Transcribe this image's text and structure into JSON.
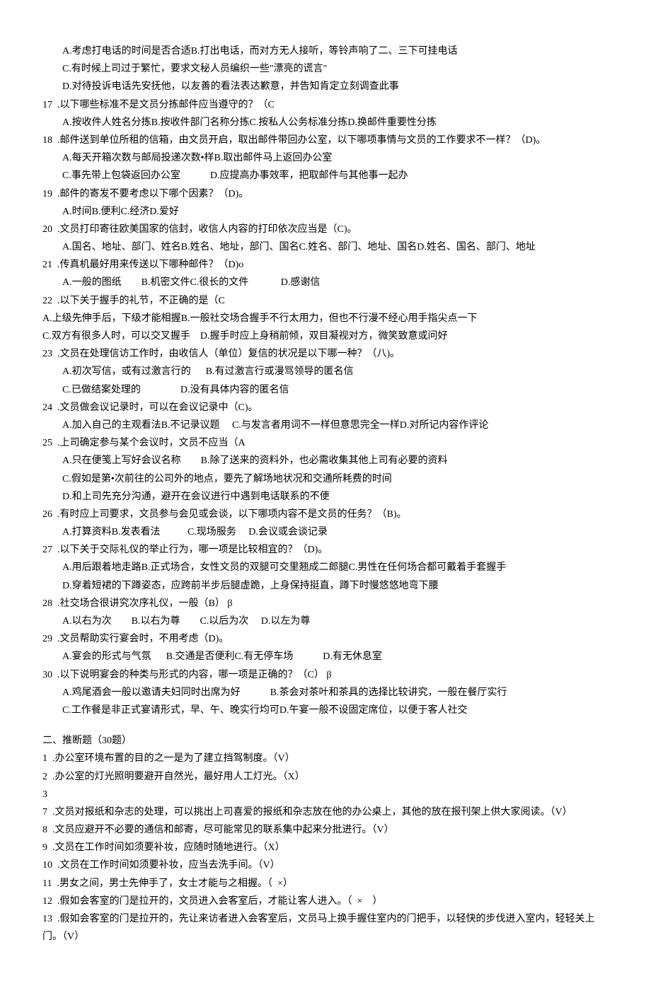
{
  "lines": [
    {
      "cls": "line indent1",
      "text": "A.考虑打电话的时间是否合适B.打出电话，而对方无人接听，等铃声响了二、三下可挂电话"
    },
    {
      "cls": "line indent1",
      "text": "C.有时候上司过于繁忙，要求文秘人员编织一些\"漂亮的谎言\""
    },
    {
      "cls": "line indent1",
      "text": "D.对待投诉电话先安抚他，以友善的看法表达歉意，并告知肯定立刻调查此事"
    },
    {
      "cls": "line",
      "text": "17  .以下哪些标准不是文员分拣邮件应当遵守的？（C"
    },
    {
      "cls": "line indent1",
      "text": "A.按收件人姓名分拣B.按收件部门名称分拣C.按私人公务标准分拣D.换邮件重要性分拣"
    },
    {
      "cls": "line",
      "text": "18  .邮件送到单位所租的信箱，由文员开启，取出邮件带回办公室，以下哪项事情与文员的工作要求不一样？（D)。"
    },
    {
      "cls": "line indent1",
      "text": "A.每天开箱次数与邮局投递次数•样B.取出邮件马上返回办公室"
    },
    {
      "cls": "line indent1",
      "text": "C.事先带上包袋返回办公室            D.应提高办事效率，把取邮件与其他事一起办"
    },
    {
      "cls": "line",
      "text": "19  .邮件的寄发不要考虑以下哪个因素？（D)。"
    },
    {
      "cls": "line indent1",
      "text": "A.时间B.便利C.经济D.爱好"
    },
    {
      "cls": "line",
      "text": "20  .文员打印寄往欧美国家的信封，收信人内容的打印依次应当是（C)。"
    },
    {
      "cls": "line indent1",
      "text": "A.国名、地址、部门、姓名B.姓名、地址，部门、国名C.姓名、部门、地址、国名D.姓名、国名、部门、地址"
    },
    {
      "cls": "line",
      "text": "21  .传真机最好用来传送以下哪种邮件？（D)o"
    },
    {
      "cls": "line indent1",
      "text": "A.一般的图纸        B.机密文件C.很长的文件             D.感谢信"
    },
    {
      "cls": "line",
      "text": "22  .以下关于握手的礼节，不正确的是（C"
    },
    {
      "cls": "line",
      "text": "A.上级先伸手后，下级才能相握B.一般社交场合握手不行太用力，但也不行漫不经心用手指尖点一下"
    },
    {
      "cls": "line",
      "text": "C.双方有很多人时，可以交叉握手    D.握手时应上身稍前倾，双目凝视对方，微笑致意或问好"
    },
    {
      "cls": "line",
      "text": "23  .文员在处理信访工作时，由收信人（单位）复信的状况是以下哪一种？（八)。"
    },
    {
      "cls": "line indent1",
      "text": "A.初次写信，或有过激言行的      B.有过激言行或漫骂领导的匿名信"
    },
    {
      "cls": "line indent1",
      "text": "C.已做结案处理的                D.没有具体内容的匿名信"
    },
    {
      "cls": "line",
      "text": "24  .文员做会议记录时，可以在会议记录中（C)。"
    },
    {
      "cls": "line indent1",
      "text": "A.加入自己的主观看法B.不记录议题     C.与发言者用词不一样但意思完全一样D.对所记内容作评论"
    },
    {
      "cls": "line",
      "text": "25  .上司确定参与某个会议时，文员不应当（A"
    },
    {
      "cls": "line indent1",
      "text": "A.只在便笺上写好会议名称        B.除了送来的资料外，也必需收集其他上司有必要的资料"
    },
    {
      "cls": "line indent1",
      "text": "C.假如是第•次前往的公司外的地点，要先了解场地状况和交通所耗费的时间"
    },
    {
      "cls": "line indent1",
      "text": "D.和上司先充分沟通，避开在会议进行中遇到电话联系的不便"
    },
    {
      "cls": "line",
      "text": "26  .有时应上司要求，文员参与会见或会谈，以下哪项内容不是文员的任务？（B)。"
    },
    {
      "cls": "line indent1",
      "text": "A.打算资料B.发表看法           C.现场服务     D.会议或会谈记录"
    },
    {
      "cls": "line",
      "text": "27  .以下关于交际礼仪的举止行为，哪一项是比较相宜的？（D)。"
    },
    {
      "cls": "line indent1",
      "text": "A.用后跟着地走路B.正式场合，女性文员的双腿可交里翘成二郎腿C.男性在任何场合都可戴着手套握手"
    },
    {
      "cls": "line indent1",
      "text": "D.穿着短裙的下蹲姿态，应跨前半步后腿虚跪，上身保持挺直，蹲下时慢悠悠地弯下腰"
    },
    {
      "cls": "line",
      "text": "28  .社交场合很讲究次序礼仪，一般（B） β"
    },
    {
      "cls": "line indent1",
      "text": "A.以右为次        B.以右为尊        C.以后为次     D.以左为尊"
    },
    {
      "cls": "line",
      "text": "29  .文员帮助实行宴会时，不用考虑（D)。"
    },
    {
      "cls": "line indent1",
      "text": "A.宴会的形式与气氛      B.交通是否便利C.有无停车场            D.有无休息室"
    },
    {
      "cls": "line",
      "text": "30  .以下说明宴会的种类与形式的内容，哪一项是正确的？（C） β"
    },
    {
      "cls": "line indent1",
      "text": "A.鸡尾酒会一般以邀请夫妇同时出席为好            B.茶会对茶叶和茶具的选择比较讲究，一般在餐厅实行"
    },
    {
      "cls": "line indent1",
      "text": "C.工作餐是非正式宴请形式，早、午、晚实行均可D.午宴一般不设固定席位，以便于客人社交"
    },
    {
      "cls": "line section",
      "text": "二、推断题（30题）"
    },
    {
      "cls": "line",
      "text": "1  .办公室环境布置的目的之一是为了建立挡驾制度。（V）"
    },
    {
      "cls": "line",
      "text": "2  .办公室的灯光照明要避开自然光，最好用人工灯光。（X）"
    },
    {
      "cls": "line",
      "text": "3"
    },
    {
      "cls": "line",
      "text": "7  .文员对报纸和杂志的处理，可以挑出上司喜爱的报纸和杂志放在他的办公桌上，其他的放在报刊架上供大家阅读。（V）"
    },
    {
      "cls": "line",
      "text": "8  .文员应避开不必要的通信和邮寄，尽可能常见的联系集中起来分批进行。（V）"
    },
    {
      "cls": "line",
      "text": "9  .文员在工作时间如须要补妆，应随时随地进行。（X）"
    },
    {
      "cls": "line",
      "text": "10  .文员在工作时间如须要补妆，应当去洗手间。（V）"
    },
    {
      "cls": "line",
      "text": "11  .男女之间，男士先伸手了，女士才能与之相握。（  ×）"
    },
    {
      "cls": "line",
      "text": "12  .假如会客室的门是拉开的，文员进入会客室后，才能让客人进入。（  ×    ）"
    },
    {
      "cls": "line",
      "text": "13  .假如会客室的门是拉开的，先让来访者进入会客室后，文员马上换手握住室内的门把手，以轻快的步伐进入室内，轻轻关上门。（V）"
    }
  ]
}
